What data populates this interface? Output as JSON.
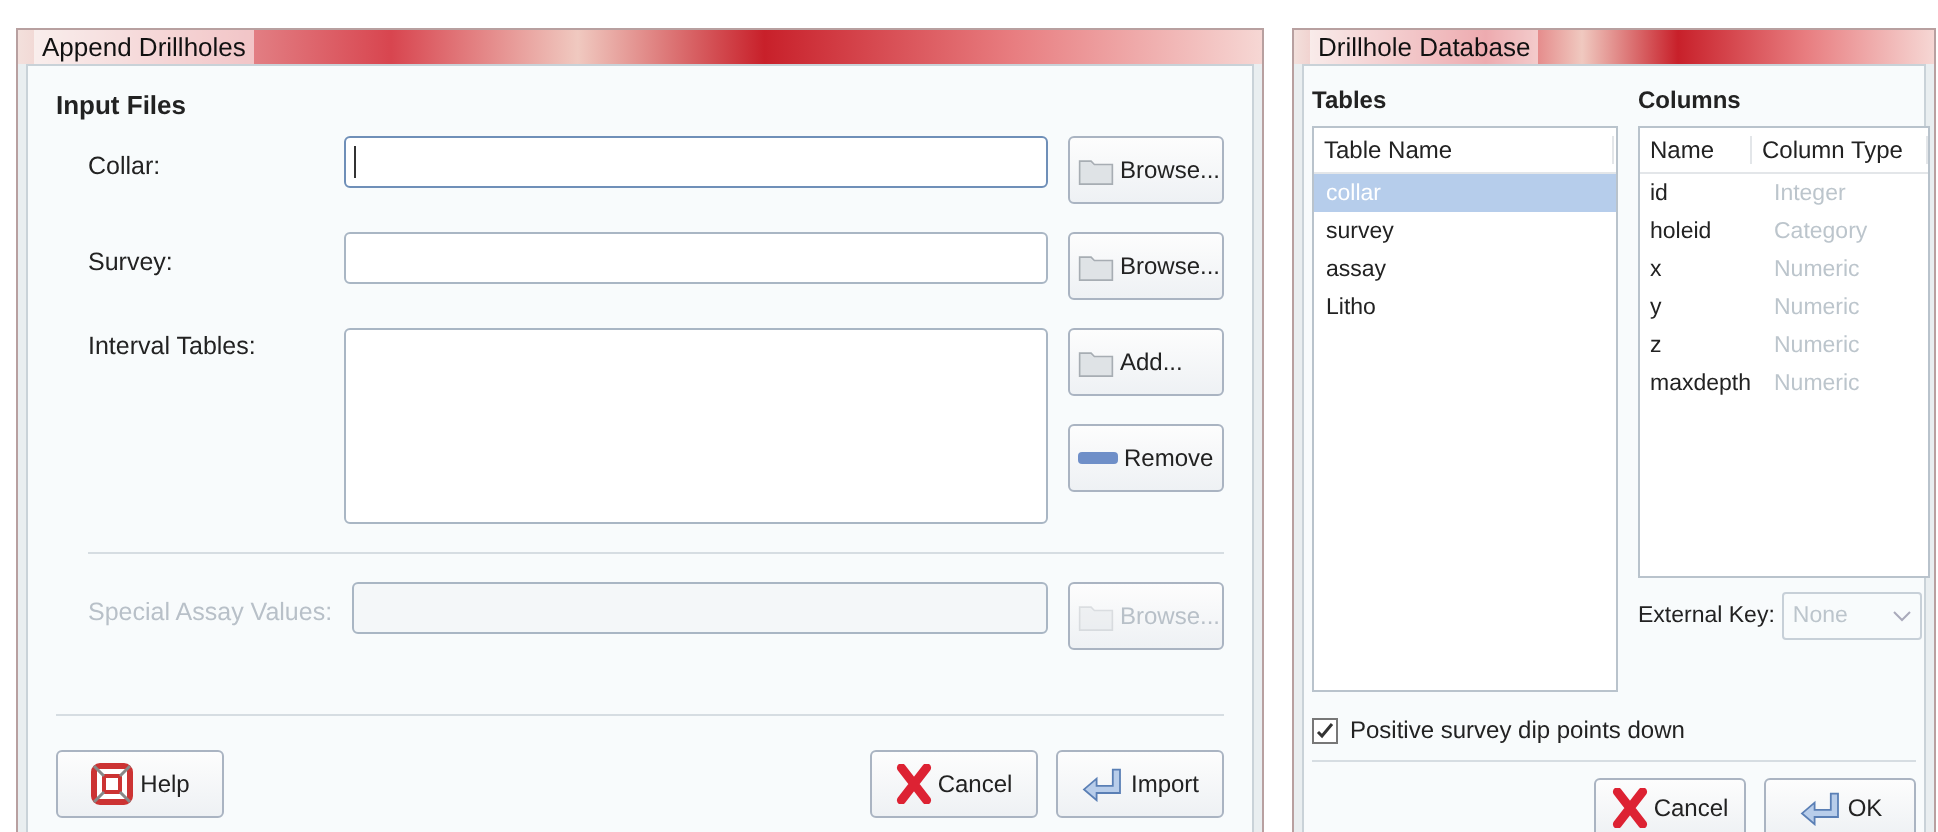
{
  "append_window": {
    "title": "Append Drillholes",
    "section": "Input Files",
    "rows": [
      {
        "kind": "text",
        "label": "Collar:",
        "focused": true,
        "disabled": false,
        "buttons": [
          "Browse..."
        ]
      },
      {
        "kind": "text",
        "label": "Survey:",
        "focused": false,
        "disabled": false,
        "buttons": [
          "Browse..."
        ]
      },
      {
        "kind": "list",
        "label": "Interval Tables:",
        "focused": false,
        "disabled": false,
        "buttons": [
          "Add...",
          "Remove"
        ]
      },
      {
        "kind": "text",
        "label": "Special Assay Values:",
        "focused": false,
        "disabled": true,
        "buttons": [
          "Browse..."
        ]
      }
    ],
    "footer_left": [
      "Help"
    ],
    "footer_right": [
      "Cancel",
      "Import"
    ]
  },
  "database_window": {
    "title": "Drillhole Database",
    "tables": {
      "heading": "Tables",
      "column": "Table Name",
      "rows": [
        {
          "name": "collar",
          "selected": true
        },
        {
          "name": "survey",
          "selected": false
        },
        {
          "name": "assay",
          "selected": false
        },
        {
          "name": "Litho",
          "selected": false
        }
      ]
    },
    "columns": {
      "heading": "Columns",
      "headers": [
        "Name",
        "Column Type"
      ],
      "rows": [
        {
          "name": "id",
          "type": "Integer"
        },
        {
          "name": "holeid",
          "type": "Category"
        },
        {
          "name": "x",
          "type": "Numeric"
        },
        {
          "name": "y",
          "type": "Numeric"
        },
        {
          "name": "z",
          "type": "Numeric"
        },
        {
          "name": "maxdepth",
          "type": "Numeric"
        }
      ]
    },
    "external_key": {
      "label": "External Key:",
      "value": "None",
      "disabled": true
    },
    "checkbox": {
      "label": "Positive survey dip points down",
      "checked": true
    },
    "buttons": [
      "Cancel",
      "OK"
    ]
  }
}
